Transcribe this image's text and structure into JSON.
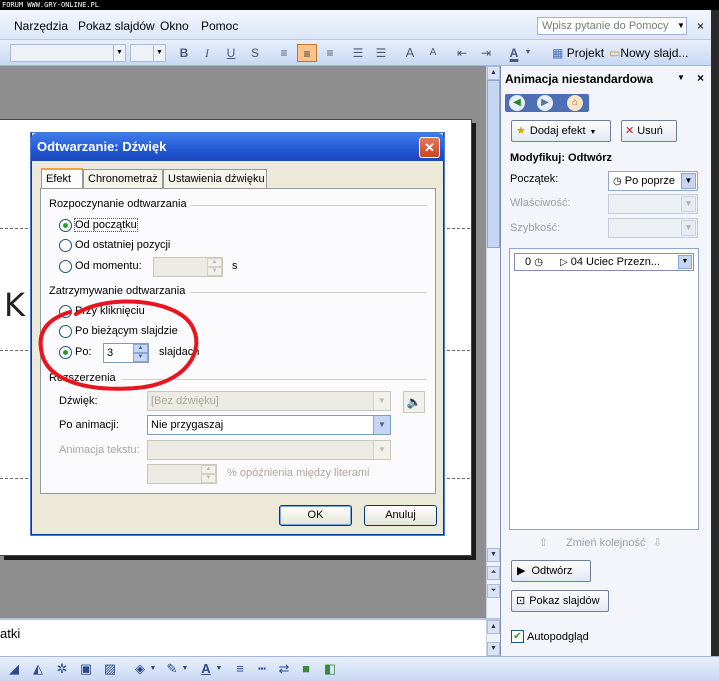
{
  "watermark": "FORUM WWW.GRY-ONLINE.PL",
  "menu": {
    "items": [
      "Narzędzia",
      "Pokaz slajdów",
      "Okno",
      "Pomoc"
    ],
    "help_placeholder": "Wpisz pytanie do Pomocy",
    "close_glyph": "×"
  },
  "format_toolbar": {
    "bold": "B",
    "italic": "I",
    "underline": "U",
    "shadow": "S",
    "font_color": "A",
    "projekt": "Projekt",
    "nowy_slajd": "Nowy slajd..."
  },
  "slide": {
    "big_letter": "K"
  },
  "notes": {
    "text": "atki"
  },
  "task_pane": {
    "title": "Animacja niestandardowa",
    "add_effect": "Dodaj efekt",
    "remove": "Usuń",
    "modify_heading": "Modyfikuj: Odtwórz",
    "start_label": "Początek:",
    "start_value": "Po poprze",
    "property_label": "Właściwość:",
    "speed_label": "Szybkość:",
    "list_item": {
      "index": "0",
      "name": "04 Uciec Przezn..."
    },
    "reorder_label": "Zmień kolejność",
    "play_button": "Odtwórz",
    "slideshow_button": "Pokaz slajdów",
    "autopreview_label": "Autopodgląd",
    "autopreview_checked": true
  },
  "dialog": {
    "title": "Odtwarzanie: Dźwięk",
    "close_glyph": "✕",
    "tabs": [
      "Efekt",
      "Chronometraż",
      "Ustawienia dźwięku"
    ],
    "active_tab": "Efekt",
    "start_group": {
      "title": "Rozpoczynanie odtwarzania",
      "options": [
        "Od początku",
        "Od ostatniej pozycji",
        "Od momentu:"
      ],
      "selected": "Od początku",
      "moment_unit": "s"
    },
    "stop_group": {
      "title": "Zatrzymywanie odtwarzania",
      "options": [
        "Przy kliknięciu",
        "Po bieżącym slajdzie",
        "Po:"
      ],
      "selected": "Po:",
      "after_value": "3",
      "after_unit": "slajdach"
    },
    "ext_group": {
      "title": "Rozszerzenia",
      "sound_label": "Dźwięk:",
      "sound_value": "[Bez dźwięku]",
      "after_anim_label": "Po animacji:",
      "after_anim_value": "Nie przygaszaj",
      "animate_text_label": "Animacja tekstu:",
      "delay_label": "% opóźnienia między literami"
    },
    "ok": "OK",
    "cancel": "Anuluj"
  },
  "colors": {
    "title_bar": "#2358d6",
    "annotation": "#e8141e",
    "radio_dot": "#21a121"
  }
}
